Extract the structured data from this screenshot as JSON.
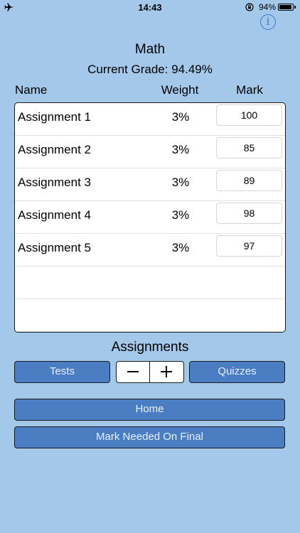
{
  "status_bar": {
    "time": "14:43",
    "battery_percent": "94%",
    "battery_level": 0.94,
    "icons": [
      "airplane-icon",
      "orientation-lock-icon",
      "battery-icon"
    ]
  },
  "header": {
    "title": "Math",
    "current_grade": "Current Grade: 94.49%",
    "info_symbol": "i"
  },
  "table": {
    "columns": {
      "name": "Name",
      "weight": "Weight",
      "mark": "Mark"
    },
    "rows": [
      {
        "name": "Assignment  1",
        "weight": "3%",
        "mark": "100"
      },
      {
        "name": "Assignment  2",
        "weight": "3%",
        "mark": "85"
      },
      {
        "name": "Assignment  3",
        "weight": "3%",
        "mark": "89"
      },
      {
        "name": "Assignment  4",
        "weight": "3%",
        "mark": "98"
      },
      {
        "name": "Assignment  5",
        "weight": "3%",
        "mark": "97"
      }
    ]
  },
  "category": {
    "label": "Assignments",
    "prev_label": "Tests",
    "next_label": "Quizzes"
  },
  "actions": {
    "home_label": "Home",
    "final_label": "Mark Needed On Final"
  },
  "colors": {
    "background": "#a4c8ea",
    "button": "#4a7dc2",
    "accent": "#3b79c9"
  }
}
